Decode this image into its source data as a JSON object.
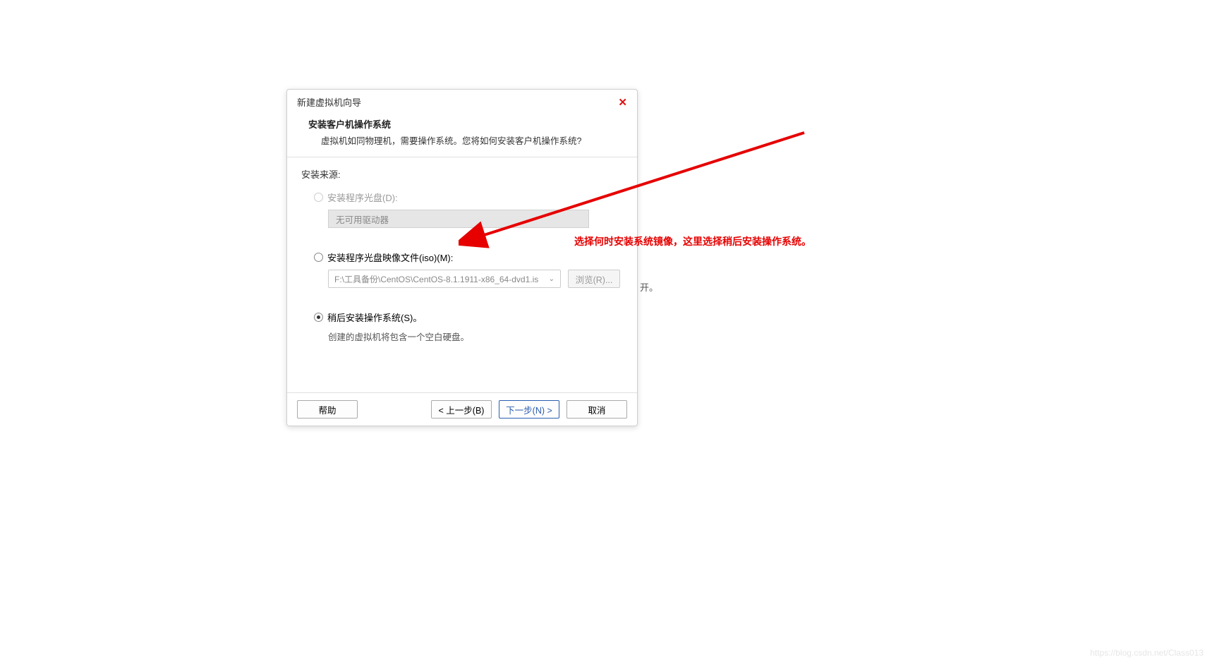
{
  "dialog": {
    "title": "新建虚拟机向导",
    "header_title": "安装客户机操作系统",
    "header_sub": "虚拟机如同物理机，需要操作系统。您将如何安装客户机操作系统?",
    "source_label": "安装来源:",
    "option_disc": {
      "label": "安装程序光盘(D):",
      "combo": "无可用驱动器"
    },
    "option_iso": {
      "label": "安装程序光盘映像文件(iso)(M):",
      "path": "F:\\工具备份\\CentOS\\CentOS-8.1.1911-x86_64-dvd1.is",
      "browse": "浏览(R)..."
    },
    "option_later": {
      "label": "稍后安装操作系统(S)。",
      "sub": "创建的虚拟机将包含一个空白硬盘。"
    },
    "buttons": {
      "help": "帮助",
      "back": "< 上一步(B)",
      "next": "下一步(N) >",
      "cancel": "取消"
    }
  },
  "annotation": "选择何时安装系统镜像，这里选择稍后安装操作系统。",
  "stray": "开。",
  "watermark": "https://blog.csdn.net/Class013"
}
